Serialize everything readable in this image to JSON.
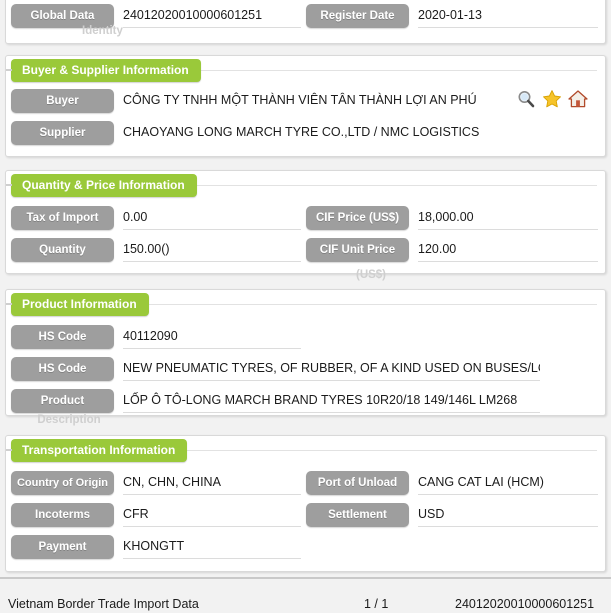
{
  "header": {
    "fields": [
      {
        "label": "Global Data",
        "value": "24012020010000601251"
      },
      {
        "label": "Register Date",
        "value": "2020-01-13"
      }
    ],
    "clipped_label": "Identity"
  },
  "sections": [
    {
      "title": "Buyer & Supplier Information",
      "rows": [
        {
          "label": "Buyer",
          "value": "CÔNG TY TNHH MỘT THÀNH VIÊN TÂN THÀNH LỢI AN PHÚ"
        },
        {
          "label": "Supplier",
          "value": "CHAOYANG LONG MARCH TYRE CO.,LTD / NMC LOGISTICS"
        }
      ],
      "icons": [
        {
          "name": "search-icon",
          "title": "Search"
        },
        {
          "name": "star-icon",
          "title": "Favorite"
        },
        {
          "name": "home-icon",
          "title": "Home"
        }
      ]
    },
    {
      "title": "Quantity & Price Information",
      "rows": [
        {
          "label": "Tax of Import",
          "value": "0.00"
        },
        {
          "label": "CIF Price (US$)",
          "value": "18,000.00"
        },
        {
          "label": "Quantity",
          "value": "150.00()"
        },
        {
          "label": "CIF Unit Price",
          "value": "120.00"
        }
      ],
      "clipped_label": "(US$)"
    },
    {
      "title": "Product Information",
      "rows": [
        {
          "label": "HS Code",
          "value": "40112090"
        },
        {
          "label": "HS Code",
          "value": "NEW PNEUMATIC TYRES, OF RUBBER, OF A KIND USED ON BUSES/LO"
        },
        {
          "label": "Product",
          "value": "LỐP Ô TÔ-LONG MARCH BRAND TYRES 10R20/18 149/146L LM268"
        }
      ],
      "clipped_label": "Description"
    },
    {
      "title": "Transportation Information",
      "rows": [
        {
          "label": "Country of Origin",
          "value": "CN, CHN, CHINA"
        },
        {
          "label": "Port of Unload",
          "value": "CANG CAT LAI (HCM)"
        },
        {
          "label": "Incoterms",
          "value": "CFR"
        },
        {
          "label": "Settlement",
          "value": "USD"
        },
        {
          "label": "Payment",
          "value": "KHONGTT"
        }
      ]
    }
  ],
  "footer": {
    "source": "Vietnam Border Trade Import Data",
    "page": "1 / 1",
    "record_id": "24012020010000601251"
  },
  "colors": {
    "section_green": "#9ac93a",
    "label_gray": "#9e9e9e",
    "page_background": "#f2f2f2",
    "card_background": "#ffffff"
  }
}
